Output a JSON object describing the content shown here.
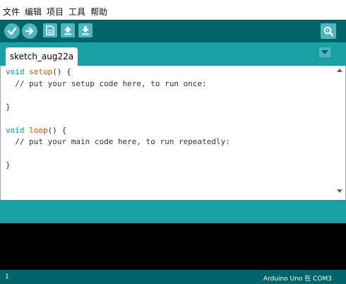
{
  "menu": [
    "文件",
    "编辑",
    "项目",
    "工具",
    "帮助"
  ],
  "toolbar": {
    "buttons": [
      {
        "name": "verify-icon"
      },
      {
        "name": "upload-icon"
      },
      {
        "name": "new-icon"
      },
      {
        "name": "open-icon"
      },
      {
        "name": "save-icon"
      }
    ],
    "serial_monitor_icon": "serial-monitor-icon"
  },
  "tabs": [
    {
      "label": "sketch_aug22a"
    }
  ],
  "editor": {
    "lines": [
      {
        "kw": "void",
        "fn": "setup",
        "rest": "() {"
      },
      {
        "text": "  // put your setup code here, to run once:"
      },
      {
        "text": ""
      },
      {
        "text": "}"
      },
      {
        "text": ""
      },
      {
        "kw": "void",
        "fn": "loop",
        "rest": "() {"
      },
      {
        "text": "  // put your main code here, to run repeatedly:"
      },
      {
        "text": ""
      },
      {
        "text": "}"
      }
    ]
  },
  "status": {
    "line_number": "1",
    "board": "Arduino Uno 在 COM3"
  },
  "colors": {
    "toolbar": "#006468",
    "tabbar": "#17a1a5",
    "button": "#4db7bb",
    "keyword": "#00979c",
    "function": "#d35400",
    "console": "#000000"
  }
}
